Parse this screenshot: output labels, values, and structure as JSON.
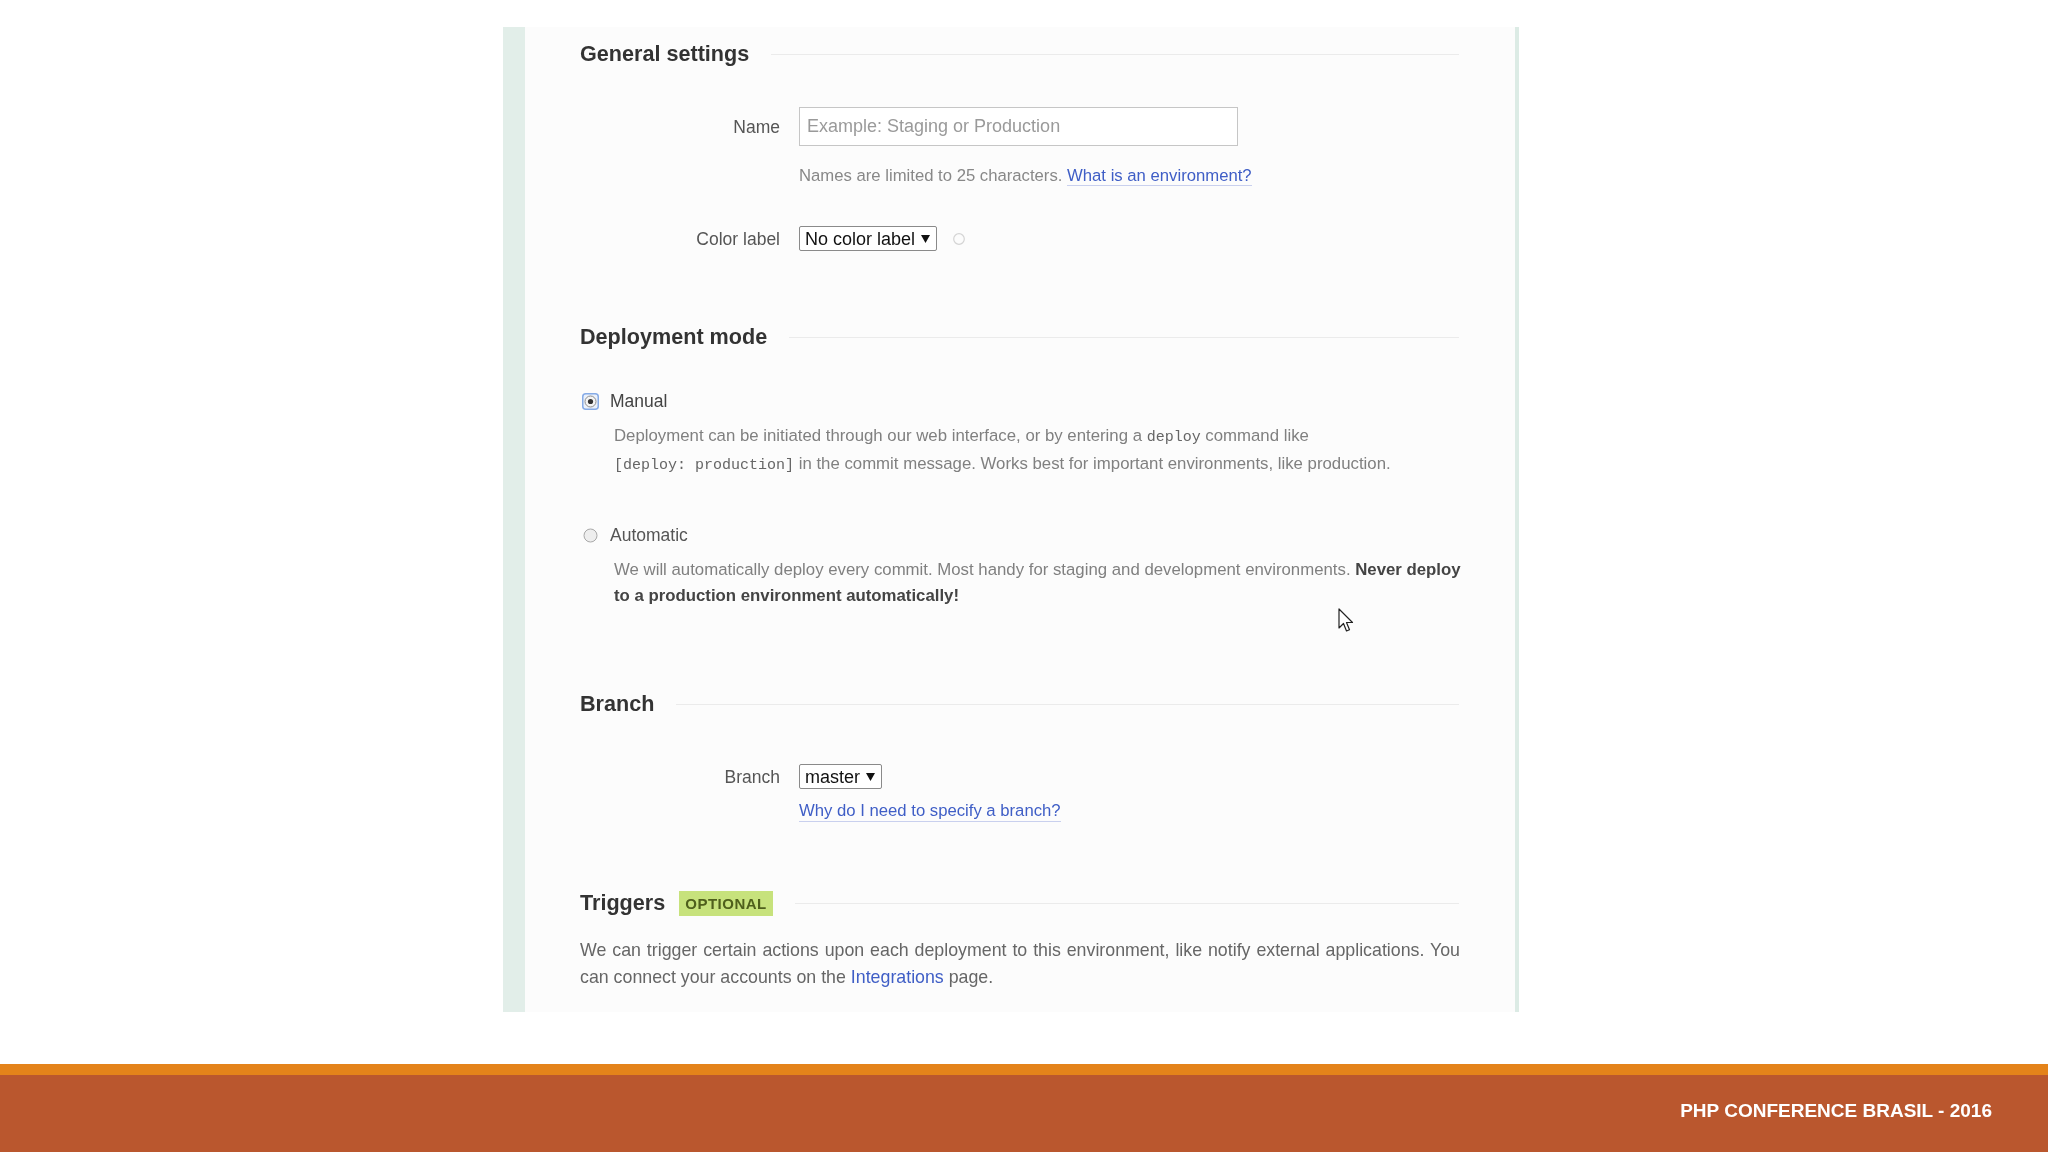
{
  "general_settings": {
    "title": "General settings",
    "name_field": {
      "label": "Name",
      "placeholder": "Example: Staging or Production",
      "help_text": "Names are limited to 25 characters.",
      "help_link": "What is an environment?"
    },
    "color_label": {
      "label": "Color label",
      "value": "No color label"
    }
  },
  "deployment_mode": {
    "title": "Deployment mode",
    "options": [
      {
        "label": "Manual",
        "selected": true,
        "description": [
          {
            "kind": "text",
            "text": "Deployment can be initiated through our web interface, or by entering a"
          },
          {
            "kind": "code",
            "text": "deploy"
          },
          {
            "kind": "text",
            "text": "command like"
          },
          {
            "kind": "code",
            "text": "[deploy: production]"
          },
          {
            "kind": "text",
            "text": "in the commit message. Works best for important environments, like production."
          }
        ]
      },
      {
        "label": "Automatic",
        "selected": false,
        "description": [
          {
            "kind": "text",
            "text": "We will automatically deploy every commit. Most handy for staging and development environments. **Never deploy to a production environment automatically!**"
          }
        ]
      }
    ]
  },
  "branch": {
    "title": "Branch",
    "label": "Branch",
    "value": "master",
    "help_link": "Why do I need to specify a branch?"
  },
  "triggers": {
    "title": "Triggers",
    "badge": "OPTIONAL",
    "text_before": "We can trigger certain actions upon each deployment to this environment, like notify external applications. You can connect your accounts on the",
    "link": "Integrations",
    "text_after": "page."
  },
  "footer": {
    "title": "PHP CONFERENCE BRASIL - 2016"
  }
}
